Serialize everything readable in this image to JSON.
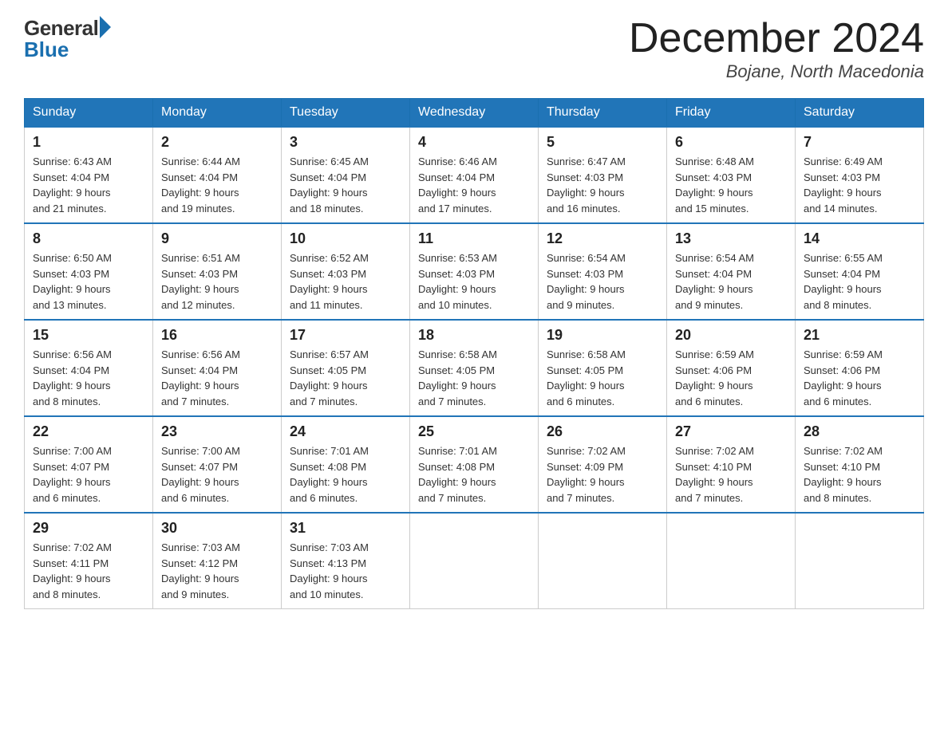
{
  "header": {
    "logo_general": "General",
    "logo_blue": "Blue",
    "title": "December 2024",
    "location": "Bojane, North Macedonia"
  },
  "days_of_week": [
    "Sunday",
    "Monday",
    "Tuesday",
    "Wednesday",
    "Thursday",
    "Friday",
    "Saturday"
  ],
  "weeks": [
    [
      {
        "day": "1",
        "sunrise": "6:43 AM",
        "sunset": "4:04 PM",
        "daylight": "9 hours and 21 minutes."
      },
      {
        "day": "2",
        "sunrise": "6:44 AM",
        "sunset": "4:04 PM",
        "daylight": "9 hours and 19 minutes."
      },
      {
        "day": "3",
        "sunrise": "6:45 AM",
        "sunset": "4:04 PM",
        "daylight": "9 hours and 18 minutes."
      },
      {
        "day": "4",
        "sunrise": "6:46 AM",
        "sunset": "4:04 PM",
        "daylight": "9 hours and 17 minutes."
      },
      {
        "day": "5",
        "sunrise": "6:47 AM",
        "sunset": "4:03 PM",
        "daylight": "9 hours and 16 minutes."
      },
      {
        "day": "6",
        "sunrise": "6:48 AM",
        "sunset": "4:03 PM",
        "daylight": "9 hours and 15 minutes."
      },
      {
        "day": "7",
        "sunrise": "6:49 AM",
        "sunset": "4:03 PM",
        "daylight": "9 hours and 14 minutes."
      }
    ],
    [
      {
        "day": "8",
        "sunrise": "6:50 AM",
        "sunset": "4:03 PM",
        "daylight": "9 hours and 13 minutes."
      },
      {
        "day": "9",
        "sunrise": "6:51 AM",
        "sunset": "4:03 PM",
        "daylight": "9 hours and 12 minutes."
      },
      {
        "day": "10",
        "sunrise": "6:52 AM",
        "sunset": "4:03 PM",
        "daylight": "9 hours and 11 minutes."
      },
      {
        "day": "11",
        "sunrise": "6:53 AM",
        "sunset": "4:03 PM",
        "daylight": "9 hours and 10 minutes."
      },
      {
        "day": "12",
        "sunrise": "6:54 AM",
        "sunset": "4:03 PM",
        "daylight": "9 hours and 9 minutes."
      },
      {
        "day": "13",
        "sunrise": "6:54 AM",
        "sunset": "4:04 PM",
        "daylight": "9 hours and 9 minutes."
      },
      {
        "day": "14",
        "sunrise": "6:55 AM",
        "sunset": "4:04 PM",
        "daylight": "9 hours and 8 minutes."
      }
    ],
    [
      {
        "day": "15",
        "sunrise": "6:56 AM",
        "sunset": "4:04 PM",
        "daylight": "9 hours and 8 minutes."
      },
      {
        "day": "16",
        "sunrise": "6:56 AM",
        "sunset": "4:04 PM",
        "daylight": "9 hours and 7 minutes."
      },
      {
        "day": "17",
        "sunrise": "6:57 AM",
        "sunset": "4:05 PM",
        "daylight": "9 hours and 7 minutes."
      },
      {
        "day": "18",
        "sunrise": "6:58 AM",
        "sunset": "4:05 PM",
        "daylight": "9 hours and 7 minutes."
      },
      {
        "day": "19",
        "sunrise": "6:58 AM",
        "sunset": "4:05 PM",
        "daylight": "9 hours and 6 minutes."
      },
      {
        "day": "20",
        "sunrise": "6:59 AM",
        "sunset": "4:06 PM",
        "daylight": "9 hours and 6 minutes."
      },
      {
        "day": "21",
        "sunrise": "6:59 AM",
        "sunset": "4:06 PM",
        "daylight": "9 hours and 6 minutes."
      }
    ],
    [
      {
        "day": "22",
        "sunrise": "7:00 AM",
        "sunset": "4:07 PM",
        "daylight": "9 hours and 6 minutes."
      },
      {
        "day": "23",
        "sunrise": "7:00 AM",
        "sunset": "4:07 PM",
        "daylight": "9 hours and 6 minutes."
      },
      {
        "day": "24",
        "sunrise": "7:01 AM",
        "sunset": "4:08 PM",
        "daylight": "9 hours and 6 minutes."
      },
      {
        "day": "25",
        "sunrise": "7:01 AM",
        "sunset": "4:08 PM",
        "daylight": "9 hours and 7 minutes."
      },
      {
        "day": "26",
        "sunrise": "7:02 AM",
        "sunset": "4:09 PM",
        "daylight": "9 hours and 7 minutes."
      },
      {
        "day": "27",
        "sunrise": "7:02 AM",
        "sunset": "4:10 PM",
        "daylight": "9 hours and 7 minutes."
      },
      {
        "day": "28",
        "sunrise": "7:02 AM",
        "sunset": "4:10 PM",
        "daylight": "9 hours and 8 minutes."
      }
    ],
    [
      {
        "day": "29",
        "sunrise": "7:02 AM",
        "sunset": "4:11 PM",
        "daylight": "9 hours and 8 minutes."
      },
      {
        "day": "30",
        "sunrise": "7:03 AM",
        "sunset": "4:12 PM",
        "daylight": "9 hours and 9 minutes."
      },
      {
        "day": "31",
        "sunrise": "7:03 AM",
        "sunset": "4:13 PM",
        "daylight": "9 hours and 10 minutes."
      },
      null,
      null,
      null,
      null
    ]
  ],
  "labels": {
    "sunrise": "Sunrise:",
    "sunset": "Sunset:",
    "daylight": "Daylight:"
  }
}
